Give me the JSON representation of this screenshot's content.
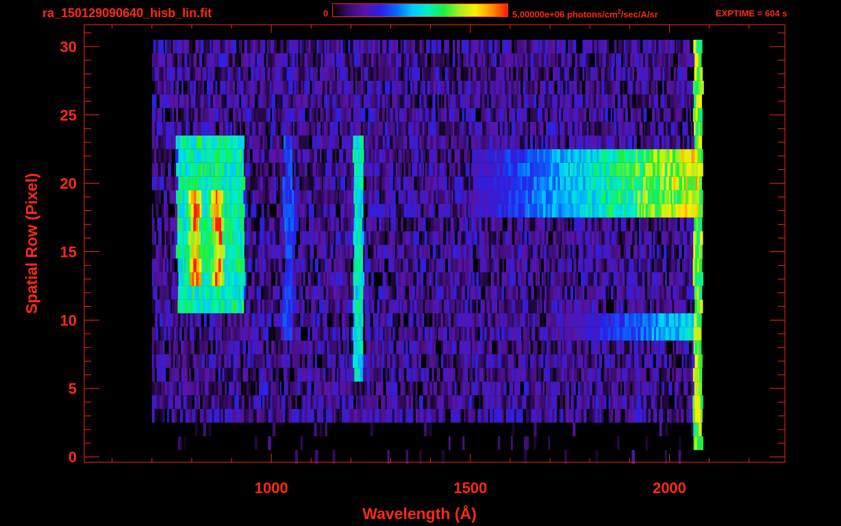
{
  "header": {
    "title": "ra_150129090640_hisb_lin.fit",
    "colorbar_min": "0",
    "colorbar_max_prefix": "5.00000e+06 photons/cm",
    "colorbar_max_sup": "2",
    "colorbar_max_suffix": "/sec/A/sr",
    "exptime": "EXPTIME = 604 s"
  },
  "colors": {
    "axis": "#ff2a12",
    "background": "#000000",
    "colormap": [
      "#000000",
      "#3a0d6e",
      "#5a14a8",
      "#2a20e6",
      "#0a64ff",
      "#00c8ff",
      "#00f0c0",
      "#18f040",
      "#a8f020",
      "#fff000",
      "#ff9000",
      "#ff1e00"
    ]
  },
  "chart_data": {
    "type": "heatmap",
    "title": "ra_150129090640_hisb_lin.fit",
    "xlabel": "Wavelength (Å)",
    "ylabel": "Spatial Row (Pixel)",
    "xlim": [
      530,
      2290
    ],
    "ylim": [
      -0.4,
      31.6
    ],
    "x_ticks": [
      1000,
      1500,
      2000
    ],
    "y_ticks": [
      0,
      5,
      10,
      15,
      20,
      25,
      30
    ],
    "colorbar": {
      "min": 0,
      "max": 5000000,
      "units": "photons/cm^2/sec/A/sr"
    },
    "exptime_s": 604,
    "rows": [
      0,
      1,
      2,
      3,
      4,
      5,
      6,
      7,
      8,
      9,
      10,
      11,
      12,
      13,
      14,
      15,
      16,
      17,
      18,
      19,
      20,
      21,
      22,
      23,
      24,
      25,
      26,
      27,
      28,
      29,
      30
    ],
    "wavelength_range": [
      700,
      2080
    ],
    "features": [
      {
        "name": "broad band",
        "x_range": [
          780,
          880
        ],
        "y_range": [
          13,
          19
        ],
        "peak_level": 1.0
      },
      {
        "name": "band halo",
        "x_range": [
          760,
          930
        ],
        "y_range": [
          11,
          23
        ],
        "peak_level": 0.6
      },
      {
        "name": "line",
        "x_center": 1040,
        "y_range": [
          9,
          23
        ],
        "peak_level": 0.35
      },
      {
        "name": "line",
        "x_center": 1216,
        "y_range": [
          6,
          23
        ],
        "peak_level": 0.55
      },
      {
        "name": "continuum",
        "x_range": [
          1500,
          2070
        ],
        "y_range": [
          18,
          22
        ],
        "peak_level": 0.85
      },
      {
        "name": "continuum",
        "x_range": [
          1700,
          2070
        ],
        "y_range": [
          9,
          10
        ],
        "peak_level": 0.55
      },
      {
        "name": "edge line",
        "x_center": 2070,
        "y_range": [
          1,
          30
        ],
        "peak_level": 0.75
      }
    ]
  }
}
